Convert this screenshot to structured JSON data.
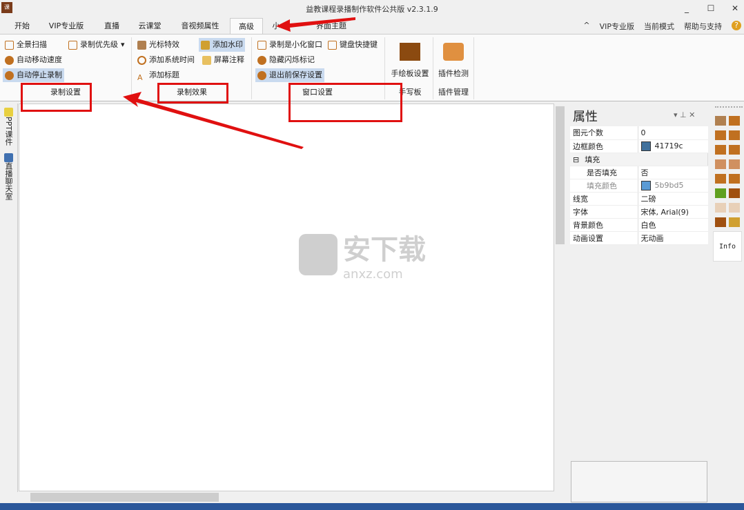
{
  "window": {
    "title": "益教课程录播制作软件公共版 v2.3.1.9",
    "app_icon_text": "课",
    "minimize": "_",
    "maximize": "☐",
    "close": "✕"
  },
  "tabs": [
    "开始",
    "VIP专业版",
    "直播",
    "云课堂",
    "音视频属性",
    "高级",
    "小",
    "界面主题"
  ],
  "active_tab": "高级",
  "right_menu": {
    "collapse": "^",
    "vip": "VIP专业版",
    "mode": "当前模式",
    "help": "帮助与支持",
    "help_icon": "?"
  },
  "ribbon": {
    "record_settings": {
      "items": [
        "全景扫描",
        "录制优先级",
        "自动移动速度",
        "自动停止录制"
      ],
      "label": "录制设置"
    },
    "record_effects": {
      "items": [
        "光标特效",
        "添加水印",
        "添加系统时间",
        "屏幕注释",
        "添加标题"
      ],
      "label": "录制效果"
    },
    "window_settings": {
      "items": [
        "录制是小化窗口",
        "键盘快捷键",
        "隐藏闪烁标记",
        "退出前保存设置"
      ],
      "label": "窗口设置"
    },
    "handwriting": {
      "button": "手绘板设置",
      "label": "手写板"
    },
    "plugins": {
      "button": "插件检测",
      "label": "插件管理"
    }
  },
  "left_panel": {
    "tabs": [
      "PPT课件",
      "直播聊天室"
    ]
  },
  "watermark": {
    "text": "安下载",
    "sub": "anxz.com"
  },
  "properties": {
    "title": "属性",
    "rows": [
      {
        "name": "图元个数",
        "value": "0"
      },
      {
        "name": "边框颜色",
        "value": "41719c",
        "color": "#41719c"
      },
      {
        "name": "填充",
        "value": "",
        "group": true,
        "toggle": "⊟"
      },
      {
        "name": "是否填充",
        "value": "否",
        "indent": true
      },
      {
        "name": "填充颜色",
        "value": "5b9bd5",
        "color": "#5b9bd5",
        "indent": true,
        "disabled": true
      },
      {
        "name": "线宽",
        "value": "二磅"
      },
      {
        "name": "字体",
        "value": "宋体, Arial(9)"
      },
      {
        "name": "背景颜色",
        "value": "白色"
      },
      {
        "name": "动画设置",
        "value": "无动画"
      }
    ]
  },
  "tools": {
    "info": "Info"
  },
  "colors": {
    "status": "#2b579a",
    "selected": "#c9daef",
    "annotation": "#e01010"
  }
}
